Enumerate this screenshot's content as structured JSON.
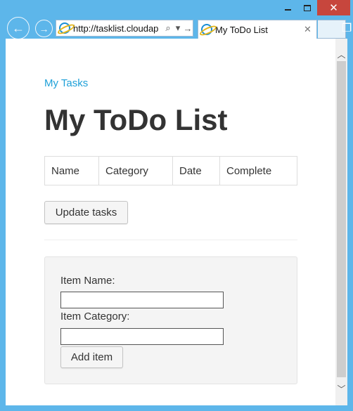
{
  "browser": {
    "address": "http://tasklist.cloudap",
    "tab_title": "My ToDo List",
    "close_glyph": "✕",
    "back_glyph": "←",
    "forward_glyph": "→",
    "search_glyph": "⌕",
    "dropdown_glyph": "▾",
    "go_glyph": "→",
    "tab_close_glyph": "✕",
    "sidebar_glyph": "❐"
  },
  "page": {
    "brand": "My Tasks",
    "title": "My ToDo List"
  },
  "task_table": {
    "headers": [
      "Name",
      "Category",
      "Date",
      "Complete"
    ]
  },
  "actions": {
    "update_label": "Update tasks"
  },
  "add_form": {
    "name_label": "Item Name:",
    "name_value": "",
    "category_label": "Item Category:",
    "category_value": "",
    "add_label": "Add item"
  },
  "colors": {
    "link": "#1ea0d8",
    "chrome": "#5db6ea",
    "close_button": "#c7463d"
  }
}
